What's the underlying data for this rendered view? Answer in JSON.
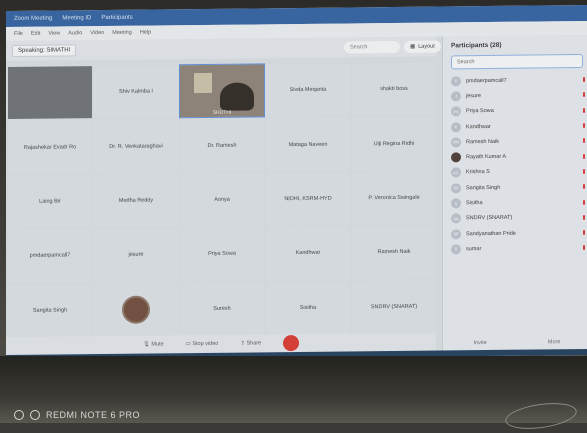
{
  "photo": {
    "watermark": "REDMI NOTE 6 PRO"
  },
  "app": {
    "speaking_label": "Speaking: SIMATHI",
    "layout_label": "Layout",
    "search_placeholder": "Search"
  },
  "tiles": [
    {
      "label": "",
      "type": "video"
    },
    {
      "label": "Shiv Kalmba I",
      "type": "name"
    },
    {
      "label": "SHUTHI",
      "type": "video2"
    },
    {
      "label": "Sivda Meqanta",
      "type": "name"
    },
    {
      "label": "shakti boss",
      "type": "name"
    },
    {
      "label": "Rajashekar Evadr Ro",
      "type": "name"
    },
    {
      "label": "Dr. R. Venkataraghavi",
      "type": "name"
    },
    {
      "label": "Dr. Ramesh",
      "type": "name"
    },
    {
      "label": "Mataga Naveen",
      "type": "name"
    },
    {
      "label": "Uiji Regina Ridhi",
      "type": "name"
    },
    {
      "label": "Laing Bir",
      "type": "name"
    },
    {
      "label": "Medha Reddy",
      "type": "name"
    },
    {
      "label": "Aonya",
      "type": "name"
    },
    {
      "label": "NIDHI, KSRM-HYD",
      "type": "name"
    },
    {
      "label": "P. Veronica Swingale",
      "type": "name"
    },
    {
      "label": "pmdaerpamcall7",
      "type": "name"
    },
    {
      "label": "jesure",
      "type": "name"
    },
    {
      "label": "Priya Sowa",
      "type": "name"
    },
    {
      "label": "Kandhwar",
      "type": "name"
    },
    {
      "label": "Ramesh Naik",
      "type": "name"
    },
    {
      "label": "Sangita Singh",
      "type": "name"
    },
    {
      "label": "",
      "type": "avatar"
    },
    {
      "label": "Suresh",
      "type": "name"
    },
    {
      "label": "Sisitha",
      "type": "name"
    },
    {
      "label": "SNDRV (SNARAT)",
      "type": "name"
    }
  ],
  "bottombar": {
    "mute": "Mute",
    "video": "Stop video",
    "share": "Share"
  },
  "panel": {
    "title": "Participants (28)",
    "search": "Search",
    "participants": [
      {
        "initials": "P",
        "name": "pmdaerpamcall7"
      },
      {
        "initials": "J",
        "name": "jesure"
      },
      {
        "initials": "PS",
        "name": "Priya Sowa"
      },
      {
        "initials": "K",
        "name": "Kandhwar"
      },
      {
        "initials": "RN",
        "name": "Ramesh Naik"
      },
      {
        "initials": "",
        "name": "Rayath Kumar A",
        "photo": true
      },
      {
        "initials": "KS",
        "name": "Krishna S"
      },
      {
        "initials": "SS",
        "name": "Sangita Singh"
      },
      {
        "initials": "S",
        "name": "Sisitha"
      },
      {
        "initials": "SN",
        "name": "SNDRV (SNARAT)"
      },
      {
        "initials": "SP",
        "name": "Sandyanathan Pride"
      },
      {
        "initials": "S",
        "name": "sumar"
      }
    ],
    "invite": "Invite",
    "more": "More"
  }
}
